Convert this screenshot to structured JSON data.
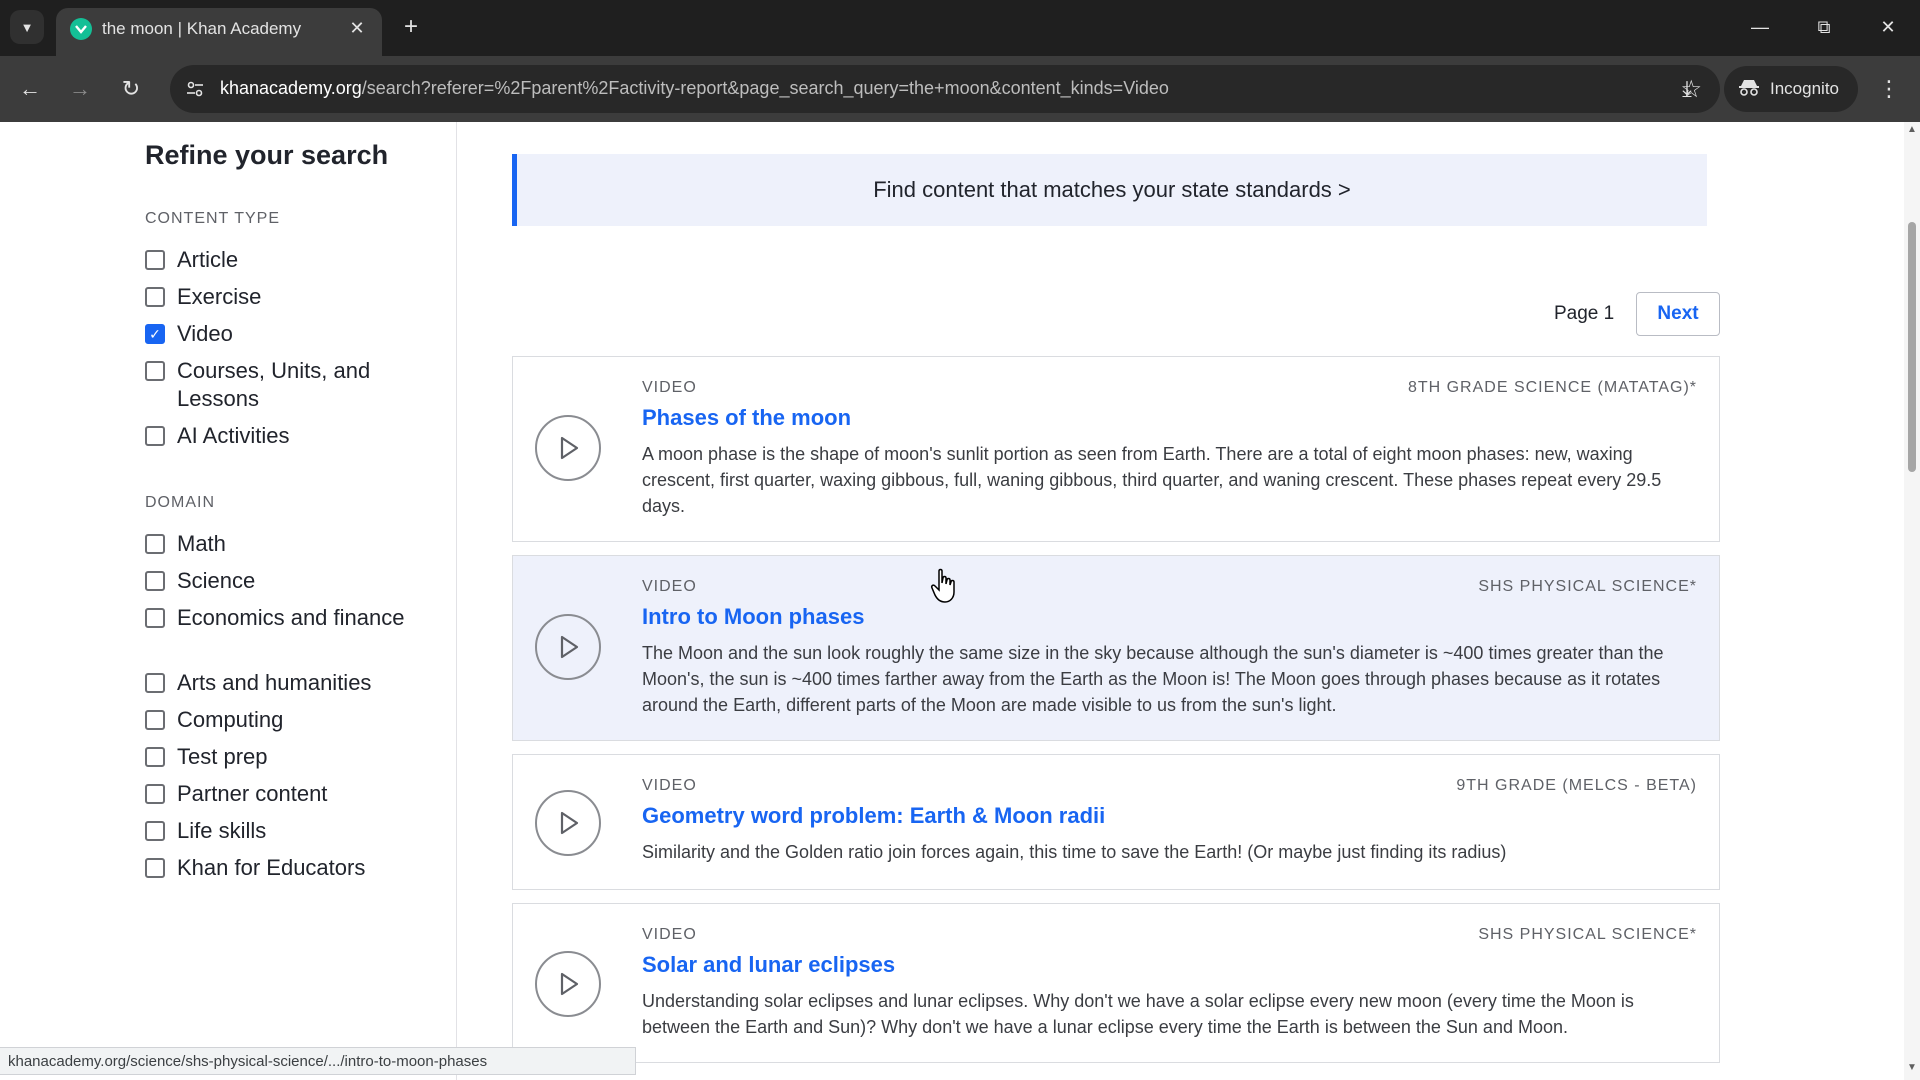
{
  "browser": {
    "tab_title": "the moon | Khan Academy",
    "url_host": "khanacademy.org",
    "url_rest": "/search?referer=%2Fparent%2Factivity-report&page_search_query=the+moon&content_kinds=Video",
    "incognito_label": "Incognito",
    "status_url": "khanacademy.org/science/shs-physical-science/.../intro-to-moon-phases"
  },
  "sidebar": {
    "title": "Refine your search",
    "content_type_label": "CONTENT TYPE",
    "content_types": [
      {
        "label": "Article",
        "checked": false
      },
      {
        "label": "Exercise",
        "checked": false
      },
      {
        "label": "Video",
        "checked": true
      },
      {
        "label": "Courses, Units, and Lessons",
        "checked": false
      },
      {
        "label": "AI Activities",
        "checked": false
      }
    ],
    "domain_label": "DOMAIN",
    "domains": [
      {
        "label": "Math",
        "checked": false
      },
      {
        "label": "Science",
        "checked": false
      },
      {
        "label": "Economics and finance",
        "checked": false
      },
      {
        "label": "Arts and humanities",
        "checked": false
      },
      {
        "label": "Computing",
        "checked": false
      },
      {
        "label": "Test prep",
        "checked": false
      },
      {
        "label": "Partner content",
        "checked": false
      },
      {
        "label": "Life skills",
        "checked": false
      },
      {
        "label": "Khan for Educators",
        "checked": false
      }
    ]
  },
  "main": {
    "banner_text": "Find content that matches your state standards >",
    "page_label": "Page 1",
    "next_label": "Next",
    "results": [
      {
        "kind": "VIDEO",
        "course": "8TH GRADE SCIENCE (MATATAG)*",
        "title": "Phases of the moon",
        "description": "A moon phase is the shape of moon's sunlit portion as seen from Earth. There are a total of eight moon phases: new, waxing crescent, first quarter, waxing gibbous, full, waning gibbous, third quarter, and waning crescent. These phases repeat every 29.5 days."
      },
      {
        "kind": "VIDEO",
        "course": "SHS PHYSICAL SCIENCE*",
        "title": "Intro to Moon phases",
        "description": "The Moon and the sun look roughly the same size in the sky because although the sun's diameter is ~400 times greater than the Moon's, the sun is ~400 times farther away from the Earth as the Moon is! The Moon goes through phases because as it rotates around the Earth, different parts of the Moon are made visible to us from the sun's light."
      },
      {
        "kind": "VIDEO",
        "course": "9TH GRADE (MELCS - BETA)",
        "title": "Geometry word problem: Earth & Moon radii",
        "description": "Similarity and the Golden ratio join forces again, this time to save the Earth! (Or maybe just finding its radius)"
      },
      {
        "kind": "VIDEO",
        "course": "SHS PHYSICAL SCIENCE*",
        "title": "Solar and lunar eclipses",
        "description": "Understanding solar eclipses and lunar eclipses. Why don't we have a solar eclipse every new moon (every time the Moon is between the Earth and Sun)? Why don't we have a lunar eclipse every time the Earth is between the Sun and Moon."
      }
    ]
  },
  "colors": {
    "accent": "#1865f2",
    "banner_bg": "#eef1fb",
    "chrome_dark": "#1f1f1f",
    "favicon": "#14bf96"
  }
}
